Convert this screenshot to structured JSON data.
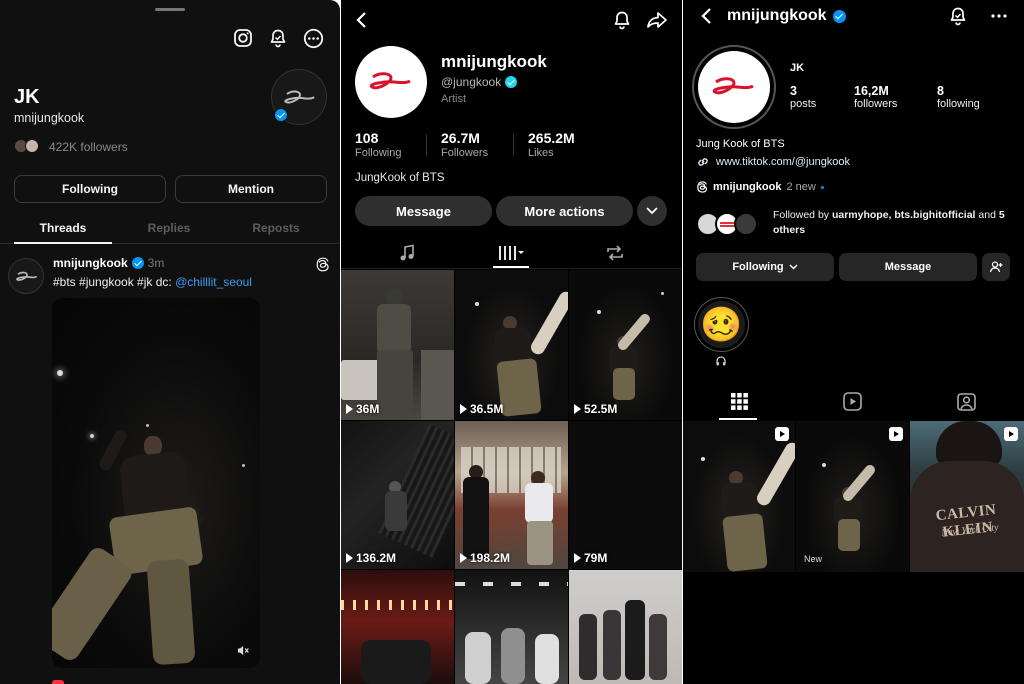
{
  "threads": {
    "display_name": "JK",
    "username": "mnijungkook",
    "followers_text": "422K followers",
    "following_button": "Following",
    "mention_button": "Mention",
    "tabs": [
      {
        "label": "Threads",
        "active": true
      },
      {
        "label": "Replies",
        "active": false
      },
      {
        "label": "Reposts",
        "active": false
      }
    ],
    "post": {
      "author": "mnijungkook",
      "time": "3m",
      "caption": "#bts #jungkook #jk dc: ",
      "mention": "@chilllit_seoul"
    },
    "icons": [
      "instagram-icon",
      "bell-icon",
      "more-icon",
      "threads-icon",
      "mute-icon"
    ]
  },
  "tiktok": {
    "username": "mnijungkook",
    "handle": "@jungkook",
    "category": "Artist",
    "stats": [
      {
        "value": "108",
        "label": "Following"
      },
      {
        "value": "26.7M",
        "label": "Followers"
      },
      {
        "value": "265.2M",
        "label": "Likes"
      }
    ],
    "bio": "JungKook of BTS",
    "message_button": "Message",
    "more_actions_button": "More actions",
    "videos": [
      {
        "views": "36M"
      },
      {
        "views": "36.5M"
      },
      {
        "views": "52.5M"
      },
      {
        "views": "136.2M"
      },
      {
        "views": "198.2M"
      },
      {
        "views": "79M"
      },
      {
        "views": ""
      },
      {
        "views": ""
      },
      {
        "views": ""
      }
    ],
    "accent_colors": {
      "background": "#000000",
      "button": "#2f2f2f"
    }
  },
  "instagram": {
    "username": "mnijungkook",
    "display_name": "JK",
    "stats": [
      {
        "value": "3",
        "label": "posts"
      },
      {
        "value": "16,2M",
        "label": "followers"
      },
      {
        "value": "8",
        "label": "following"
      }
    ],
    "bio": "Jung Kook of BTS",
    "link": "www.tiktok.com/@jungkook",
    "threads_name": "mnijungkook",
    "threads_new": "2 new",
    "followed_by_prefix": "Followed by ",
    "followed_by_names": "uarmyhope, bts.bighitofficial",
    "followed_by_and": " and ",
    "followed_by_others": "5 others",
    "following_button": "Following",
    "message_button": "Message",
    "highlight_emoji": "🥴",
    "posts": [
      {
        "label": ""
      },
      {
        "label": "New"
      },
      {
        "label": "CALVIN KLEIN",
        "sublabel": "New York City"
      }
    ],
    "accent_colors": {
      "link": "#e0f1ff",
      "button": "#262626"
    }
  }
}
